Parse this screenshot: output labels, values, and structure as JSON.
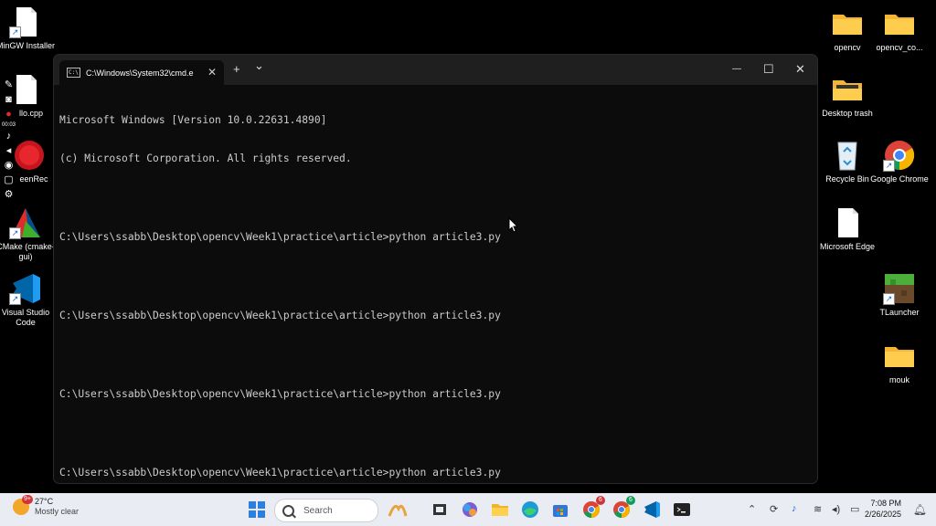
{
  "desktop": {
    "left_icons": [
      {
        "label": "MinGW Installer"
      },
      {
        "label": "llo.cpp"
      },
      {
        "label": "eenRec"
      },
      {
        "label": "CMake (cmake-gui)"
      },
      {
        "label": "Visual Studio Code"
      }
    ],
    "right_icons": [
      {
        "label": "opencv"
      },
      {
        "label": "opencv_co..."
      },
      {
        "label": "Desktop trash"
      },
      {
        "label": "Recycle Bin"
      },
      {
        "label": "Google Chrome"
      },
      {
        "label": "Microsoft Edge"
      },
      {
        "label": "TLauncher"
      },
      {
        "label": "mouk"
      }
    ]
  },
  "recorder": {
    "time": "00:03"
  },
  "terminal": {
    "tab_title": "C:\\Windows\\System32\\cmd.e",
    "new_tab": "+",
    "dropdown": "⌄",
    "minimize": "—",
    "maximize": "☐",
    "close": "✕",
    "lines": [
      "Microsoft Windows [Version 10.0.22631.4890]",
      "(c) Microsoft Corporation. All rights reserved.",
      "",
      "C:\\Users\\ssabb\\Desktop\\opencv\\Week1\\practice\\article>python article3.py",
      "",
      "C:\\Users\\ssabb\\Desktop\\opencv\\Week1\\practice\\article>python article3.py",
      "",
      "C:\\Users\\ssabb\\Desktop\\opencv\\Week1\\practice\\article>python article3.py",
      "",
      "C:\\Users\\ssabb\\Desktop\\opencv\\Week1\\practice\\article>python article3.py"
    ]
  },
  "taskbar": {
    "weather": {
      "temp": "27°C",
      "condition": "Mostly clear",
      "badge": "9+"
    },
    "search_label": "Search",
    "pinned": [
      {
        "name": "windows-start-icon",
        "color": "#2a7fe0"
      },
      {
        "name": "app-icon-1",
        "color": "#e8a33c"
      },
      {
        "name": "task-view-icon",
        "color": "#333333"
      },
      {
        "name": "copilot-icon",
        "color": "#7b5bd6"
      },
      {
        "name": "file-explorer-icon",
        "color": "#f0b429"
      },
      {
        "name": "edge-icon",
        "color": "#1d9bd7"
      },
      {
        "name": "store-icon",
        "color": "#3273dc"
      },
      {
        "name": "chrome-icon",
        "color": "#db4437"
      },
      {
        "name": "chrome-profile-icon",
        "color": "#0f9d58"
      },
      {
        "name": "vscode-icon",
        "color": "#0078d4"
      },
      {
        "name": "terminal-icon",
        "color": "#222222"
      }
    ],
    "chrome_badge": "6",
    "chrome2_badge": "6",
    "clock": {
      "time": "7:08 PM",
      "date": "2/26/2025"
    }
  }
}
